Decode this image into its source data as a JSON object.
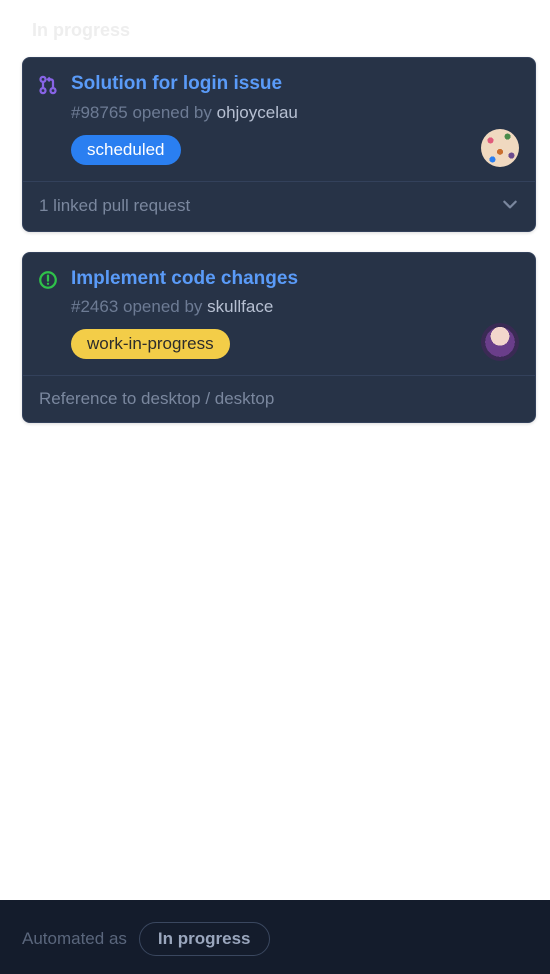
{
  "column": {
    "header": "In progress"
  },
  "cards": [
    {
      "icon": "pr",
      "title": "Solution for login issue",
      "issue_number": "#98765",
      "opened_by_text": "opened by",
      "author": "ohjoycelau",
      "label": {
        "text": "scheduled",
        "color": "blue"
      },
      "avatar_style": "dots",
      "footer": {
        "type": "linked",
        "text": "1 linked pull request",
        "expandable": true
      }
    },
    {
      "icon": "issue-open",
      "title": "Implement code changes",
      "issue_number": "#2463",
      "opened_by_text": "opened by",
      "author": "skullface",
      "label": {
        "text": "work-in-progress",
        "color": "yellow"
      },
      "avatar_style": "purple",
      "footer": {
        "type": "reference",
        "text": "Reference to desktop / desktop",
        "expandable": false
      }
    }
  ],
  "bottom": {
    "label": "Automated as",
    "status": "In progress"
  },
  "colors": {
    "card_bg": "#273347",
    "link": "#5a9bf8",
    "muted": "#6d7b94",
    "pr_icon": "#8864e6",
    "issue_icon": "#2fc24a"
  }
}
